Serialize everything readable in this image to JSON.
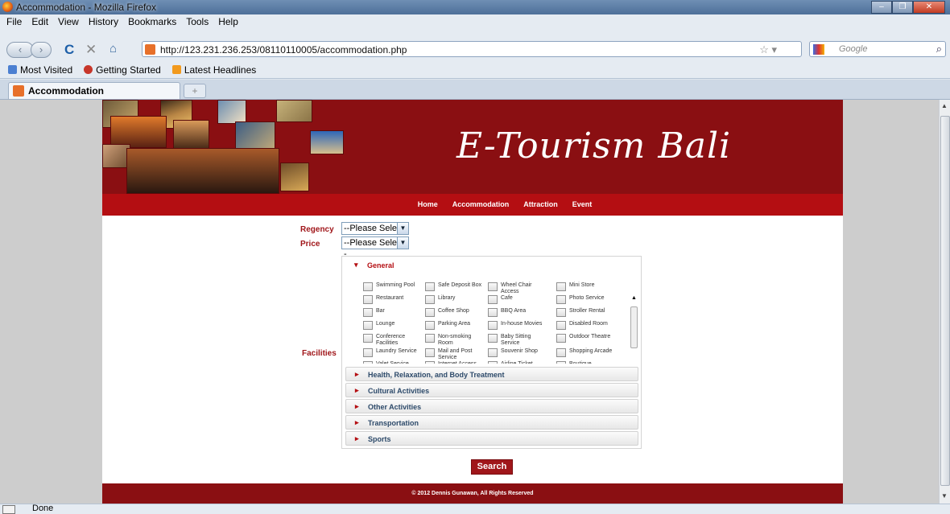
{
  "window": {
    "title": "Accommodation - Mozilla Firefox",
    "controls": [
      "–",
      "❐",
      "✕"
    ]
  },
  "menu": [
    "File",
    "Edit",
    "View",
    "History",
    "Bookmarks",
    "Tools",
    "Help"
  ],
  "nav": {
    "url": "http://123.231.236.253/08110110005/accommodation.php",
    "search_placeholder": "Google",
    "icons": [
      "back-icon",
      "forward-icon",
      "reload-icon",
      "stop-icon",
      "home-icon"
    ]
  },
  "bookmarks": [
    "Most Visited",
    "Getting Started",
    "Latest Headlines"
  ],
  "tab": {
    "label": "Accommodation",
    "new": "+"
  },
  "site": {
    "logo": "E-Tourism Bali",
    "nav": [
      "Home",
      "Accommodation",
      "Attraction",
      "Event"
    ],
    "form": {
      "regency_label": "Regency",
      "regency_value": "--Please Select--",
      "price_label": "Price",
      "price_value": "--Please Select--",
      "facilities_label": "Facilities",
      "general": "General",
      "general_items": [
        "Swimming Pool",
        "Safe Deposit Box",
        "Wheel Chair Access",
        "Mini Store",
        "Restaurant",
        "Library",
        "Cafe",
        "Photo Service",
        "Bar",
        "Coffee Shop",
        "BBQ Area",
        "Stroller Rental",
        "Lounge",
        "Parking Area",
        "In-house Movies",
        "Disabled Room",
        "Conference Facilities",
        "Non-smoking Room",
        "Baby Sitting Service",
        "Outdoor Theatre",
        "Laundry Service",
        "Mail and Post Service",
        "Souvenir Shop",
        "Shopping Arcade",
        "Valet Service",
        "Internet Access",
        "Airline Ticket",
        "Boutique"
      ],
      "sections": [
        "Health, Relaxation, and Body Treatment",
        "Cultural Activities",
        "Other Activities",
        "Transportation",
        "Sports"
      ],
      "search_button": "Search"
    },
    "footer": "© 2012 Dennis Gunawan, All Rights Reserved"
  },
  "status": "Done",
  "colors": {
    "brand_dark": "#8a0f12",
    "brand": "#b40e12",
    "label": "#a0161a"
  }
}
